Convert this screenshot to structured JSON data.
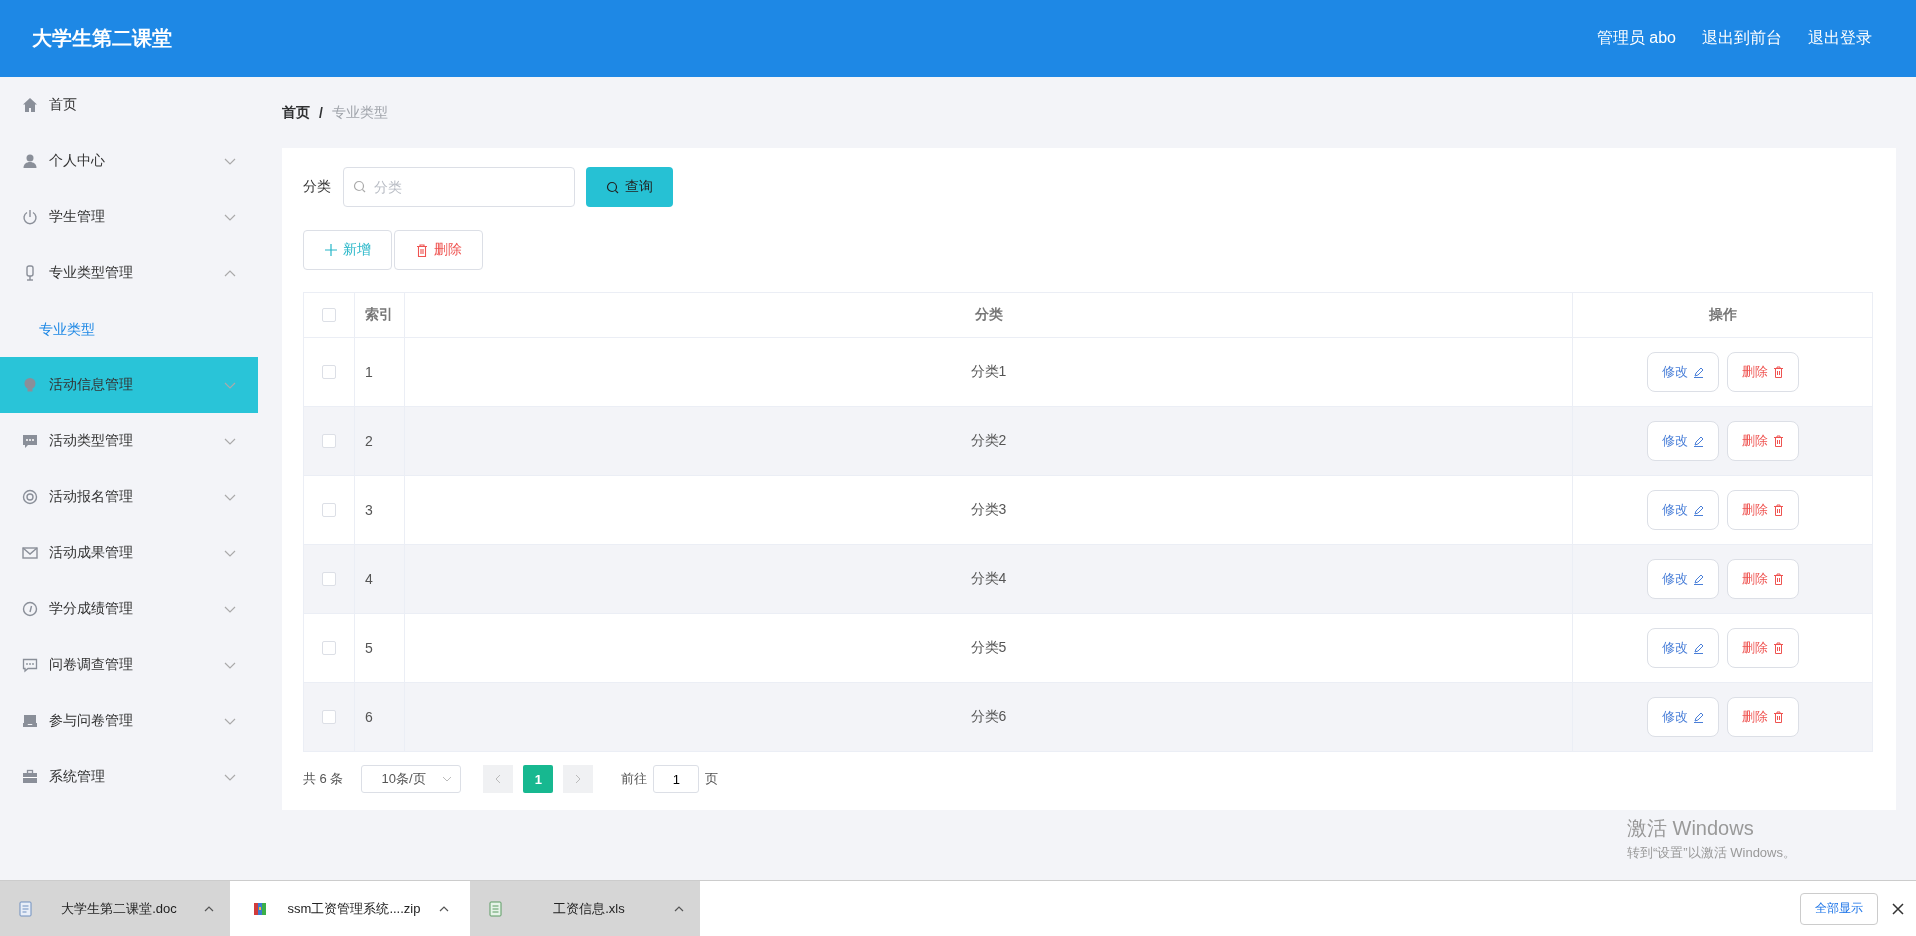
{
  "header": {
    "title": "大学生第二课堂",
    "user": "管理员 abo",
    "links": [
      "退出到前台",
      "退出登录"
    ]
  },
  "sidebar": {
    "items": [
      {
        "label": "首页",
        "kind": "link",
        "selected": false
      },
      {
        "label": "个人中心",
        "kind": "submenu",
        "expanded": false,
        "selected": false
      },
      {
        "label": "学生管理",
        "kind": "submenu",
        "expanded": false,
        "selected": false
      },
      {
        "label": "专业类型管理",
        "kind": "submenu",
        "expanded": true,
        "selected": false,
        "children": [
          {
            "label": "专业类型",
            "selected": true
          }
        ]
      },
      {
        "label": "活动信息管理",
        "kind": "submenu",
        "expanded": false,
        "selected": true
      },
      {
        "label": "活动类型管理",
        "kind": "submenu",
        "expanded": false,
        "selected": false
      },
      {
        "label": "活动报名管理",
        "kind": "submenu",
        "expanded": false,
        "selected": false
      },
      {
        "label": "活动成果管理",
        "kind": "submenu",
        "expanded": false,
        "selected": false
      },
      {
        "label": "学分成绩管理",
        "kind": "submenu",
        "expanded": false,
        "selected": false
      },
      {
        "label": "问卷调查管理",
        "kind": "submenu",
        "expanded": false,
        "selected": false
      },
      {
        "label": "参与问卷管理",
        "kind": "submenu",
        "expanded": false,
        "selected": false
      },
      {
        "label": "系统管理",
        "kind": "submenu",
        "expanded": false,
        "selected": false
      }
    ]
  },
  "breadcrumb": {
    "separator": "/",
    "items": [
      {
        "label": "首页",
        "current": false
      },
      {
        "label": "专业类型",
        "current": true
      }
    ]
  },
  "search": {
    "label": "分类",
    "placeholder": "分类",
    "button": "查询"
  },
  "actions": [
    {
      "label": "新增",
      "kind": "add"
    },
    {
      "label": "删除",
      "kind": "delete"
    }
  ],
  "table": {
    "select_all": {
      "checked": false
    },
    "columns": [
      "索引",
      "分类",
      "操作"
    ],
    "rows": [
      {
        "checked": false,
        "index": "1",
        "category": "分类1",
        "edit": "修改",
        "delete": "删除"
      },
      {
        "checked": false,
        "index": "2",
        "category": "分类2",
        "edit": "修改",
        "delete": "删除"
      },
      {
        "checked": false,
        "index": "3",
        "category": "分类3",
        "edit": "修改",
        "delete": "删除"
      },
      {
        "checked": false,
        "index": "4",
        "category": "分类4",
        "edit": "修改",
        "delete": "删除"
      },
      {
        "checked": false,
        "index": "5",
        "category": "分类5",
        "edit": "修改",
        "delete": "删除"
      },
      {
        "checked": false,
        "index": "6",
        "category": "分类6",
        "edit": "修改",
        "delete": "删除"
      }
    ]
  },
  "pagination": {
    "total": "共 6 条",
    "page_size": "10条/页",
    "pages": [
      {
        "label": "1",
        "selected": true
      }
    ],
    "jump_label": "前往",
    "jump_value": "1",
    "jump_suffix": "页"
  },
  "activation_notice": {
    "title": "激活 Windows",
    "text": "转到“设置”以激活 Windows。"
  },
  "downloads": {
    "items": [
      {
        "name": "大学生第二课堂.doc",
        "kind": "doc",
        "selected": false
      },
      {
        "name": "ssm工资管理系统....zip",
        "kind": "zip",
        "selected": true
      },
      {
        "name": "工资信息.xls",
        "kind": "xls",
        "selected": false
      }
    ],
    "show_all": "全部显示"
  }
}
